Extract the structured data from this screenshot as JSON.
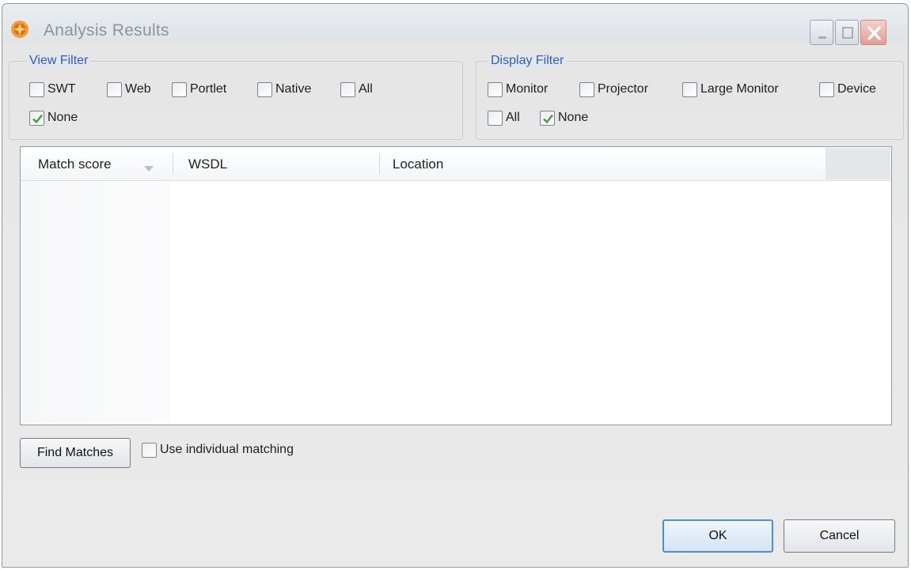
{
  "window": {
    "title": "Analysis Results",
    "accent_color": "#2f5cc3"
  },
  "view_filter": {
    "legend": "View Filter",
    "options": [
      {
        "label": "SWT",
        "checked": false
      },
      {
        "label": "Web",
        "checked": false
      },
      {
        "label": "Portlet",
        "checked": false
      },
      {
        "label": "Native",
        "checked": false
      },
      {
        "label": "All",
        "checked": false
      },
      {
        "label": "None",
        "checked": true
      }
    ]
  },
  "display_filter": {
    "legend": "Display Filter",
    "options": [
      {
        "label": "Monitor",
        "checked": false
      },
      {
        "label": "Projector",
        "checked": false
      },
      {
        "label": "Large Monitor",
        "checked": false
      },
      {
        "label": "Device",
        "checked": false
      },
      {
        "label": "All",
        "checked": false
      },
      {
        "label": "None",
        "checked": true
      }
    ]
  },
  "results_table": {
    "columns": [
      "Match score",
      "WSDL",
      "Location"
    ],
    "sorted_column": "Match score",
    "rows": []
  },
  "actions": {
    "find_matches": "Find Matches",
    "individual_matching": {
      "label": "Use individual matching",
      "checked": false
    },
    "ok": "OK",
    "cancel": "Cancel"
  }
}
